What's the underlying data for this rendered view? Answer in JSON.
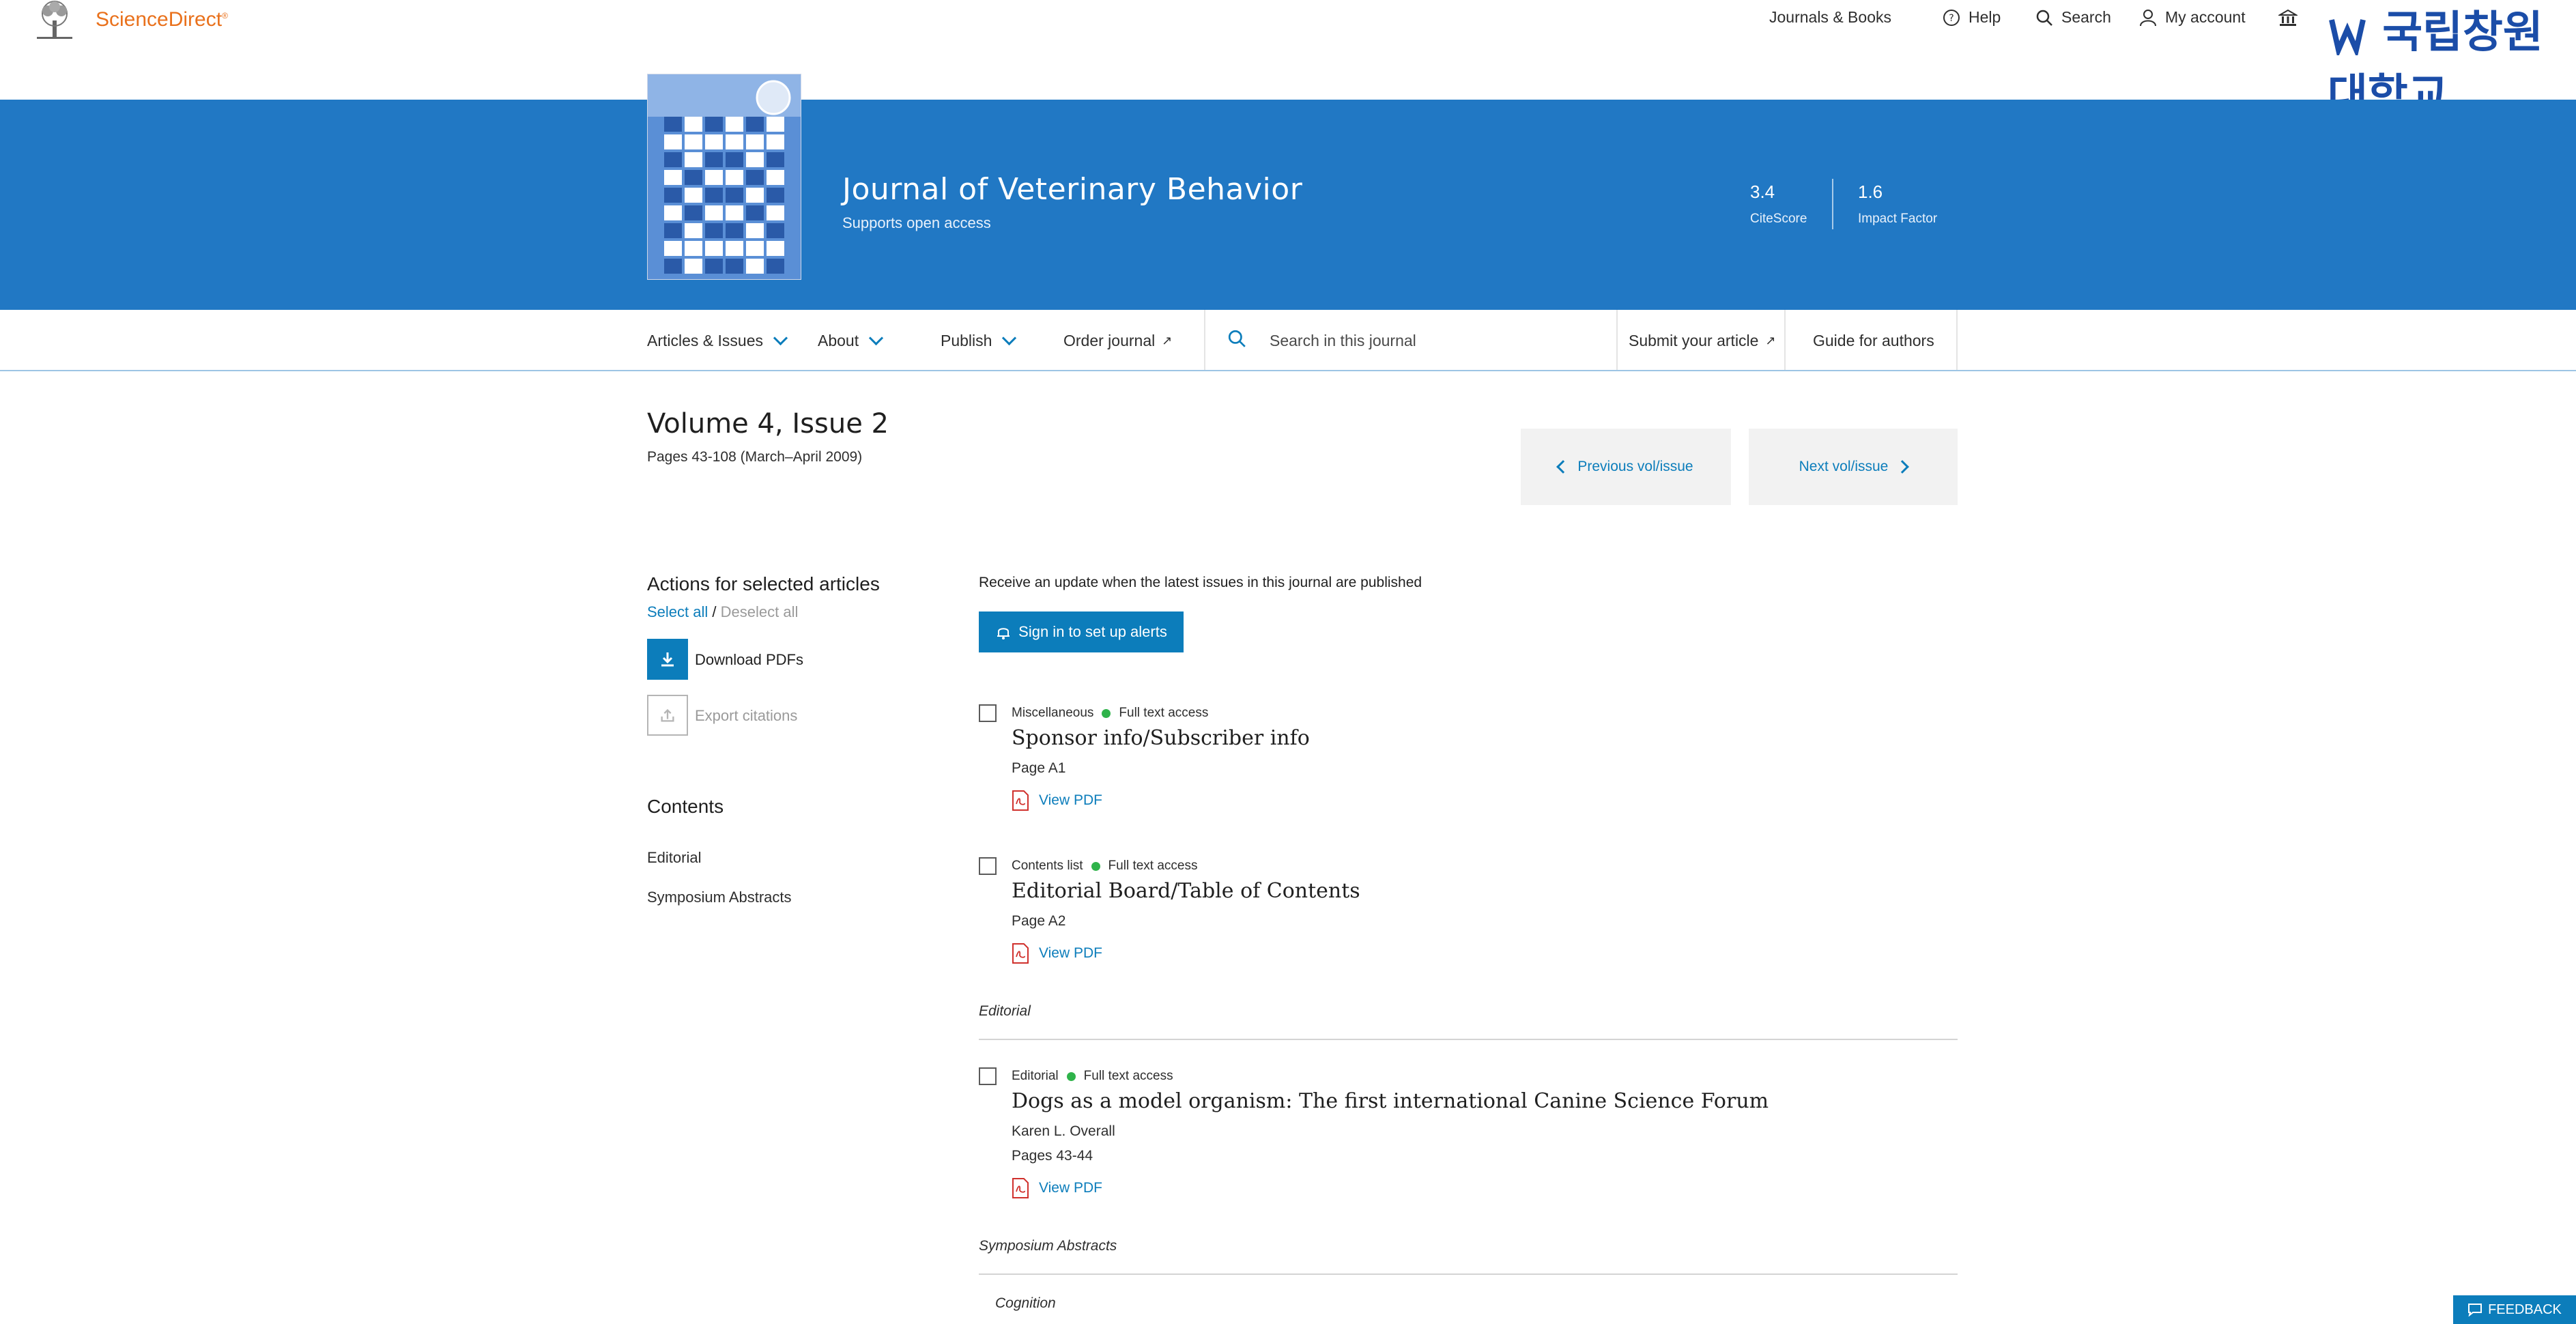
{
  "header": {
    "brand": "ScienceDirect",
    "brand_mark": "®",
    "nav": {
      "journals_books": "Journals & Books",
      "help": "Help",
      "search": "Search",
      "my_account": "My account"
    },
    "institution_logo_text": "국립창원대학교"
  },
  "journal": {
    "title": "Journal of Veterinary Behavior",
    "subtitle": "Supports open access",
    "metrics": [
      {
        "value": "3.4",
        "label": "CiteScore"
      },
      {
        "value": "1.6",
        "label": "Impact Factor"
      }
    ]
  },
  "journal_nav": {
    "articles_issues": "Articles & Issues",
    "about": "About",
    "publish": "Publish",
    "order_journal": "Order journal",
    "search_placeholder": "Search in this journal",
    "submit_article": "Submit your article",
    "guide_authors": "Guide for authors",
    "ext_mark": "↗"
  },
  "issue": {
    "title": "Volume 4, Issue 2",
    "pages": "Pages 43-108 (March–April 2009)",
    "prev": "Previous vol/issue",
    "next": "Next vol/issue"
  },
  "actions": {
    "title": "Actions for selected articles",
    "select_all": "Select all",
    "separator": "/",
    "deselect_all": "Deselect all",
    "download_pdfs": "Download PDFs",
    "export_citations": "Export citations"
  },
  "contents": {
    "title": "Contents",
    "items": [
      "Editorial",
      "Symposium Abstracts"
    ]
  },
  "alerts": {
    "text": "Receive an update when the latest issues in this journal are published",
    "button": "Sign in to set up alerts"
  },
  "articles": [
    {
      "type": "Miscellaneous",
      "access": "Full text access",
      "title": "Sponsor info/Subscriber info",
      "author": "",
      "pages": "Page A1",
      "pdf": "View PDF"
    },
    {
      "type": "Contents list",
      "access": "Full text access",
      "title": "Editorial Board/Table of Contents",
      "author": "",
      "pages": "Page A2",
      "pdf": "View PDF"
    },
    {
      "type": "Editorial",
      "access": "Full text access",
      "title": "Dogs as a model organism: The first international Canine Science Forum",
      "author": "Karen L. Overall",
      "pages": "Pages 43-44",
      "pdf": "View PDF"
    }
  ],
  "sections": {
    "editorial": "Editorial",
    "symposium": "Symposium Abstracts",
    "cognition": "Cognition"
  },
  "feedback": "FEEDBACK",
  "colors": {
    "brand_orange": "#e9711c",
    "banner_blue": "#2178c4",
    "link_blue": "#0c7dbb",
    "access_green": "#2fb34a"
  }
}
